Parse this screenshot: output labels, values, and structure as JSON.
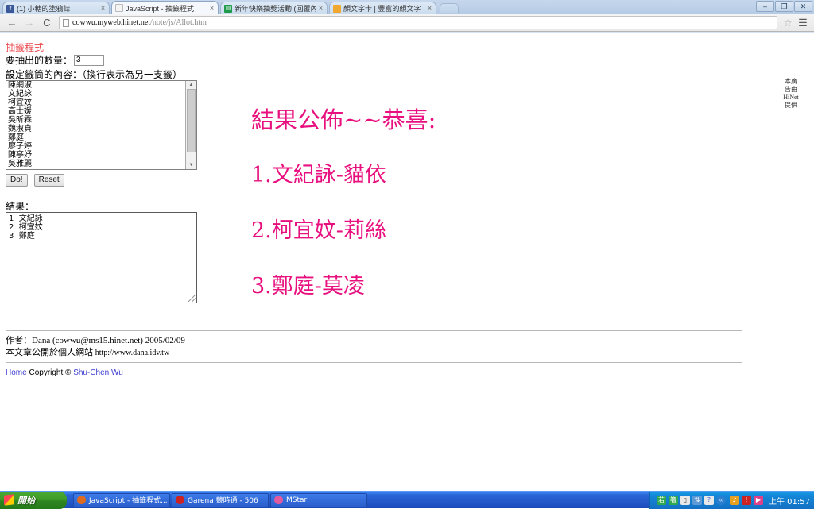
{
  "browser": {
    "tabs": [
      {
        "label": "(1) 小糖的塗鴉誌",
        "favicon": "facebook-icon",
        "active": false
      },
      {
        "label": "JavaScript - 抽籤程式",
        "favicon": "document-icon",
        "active": true
      },
      {
        "label": "新年快樂抽獎活動 (回覆內",
        "favicon": "spreadsheet-icon",
        "active": false
      },
      {
        "label": "顏文字卡 | 豐富的顏文字",
        "favicon": "page-orange-icon",
        "active": false
      }
    ],
    "tab_close_label": "×",
    "new_tab_label": "",
    "window_controls": {
      "minimize": "–",
      "restore": "❐",
      "close": "✕"
    },
    "nav": {
      "back": "←",
      "forward": "→",
      "reload": "C"
    },
    "url": {
      "domain": "cowwu.myweb.hinet.net",
      "path": "/note/js/Allot.htm"
    },
    "bookmark_star": "☆",
    "menu_glyph": "☰"
  },
  "page": {
    "app_title": "抽籤程式",
    "quantity_label": "要抽出的數量：",
    "quantity_value": "3",
    "pool_label": "設定籤筒的內容：（換行表示為另一支籤）",
    "pool_names": [
      "陳網淑",
      "文紀詠",
      "柯宜妏",
      "高士媛",
      "吳昕霖",
      "魏淑貞",
      "鄭庭",
      "廖子婷",
      "陳亭妤",
      "吳雅麗"
    ],
    "buttons": {
      "do": "Do!",
      "reset": "Reset"
    },
    "result_label": "結果：",
    "result_lines": [
      "1  文紀詠",
      "2  柯宜妏",
      "3  鄭庭"
    ],
    "announcement": {
      "heading": "結果公佈~~恭喜:",
      "winners": [
        "1.文紀詠-貓依",
        "2.柯宜妏-莉絲",
        "3.鄭庭-莫凌"
      ],
      "color": "#e8107f"
    },
    "ad_column": [
      "本廣",
      "告由",
      "HiNet",
      "提供"
    ],
    "footer": {
      "author_line": "作者：Dana (cowwu@ms15.hinet.net) 2005/02/09",
      "site_line_cjk": "本文章公開於個人網站 ",
      "site_line_url": "http://www.dana.idv.tw",
      "home_link": "Home",
      "copyright_text": "Copyright © ",
      "copyright_owner": "Shu-Chen Wu"
    }
  },
  "taskbar": {
    "start_label": "開始",
    "items": [
      {
        "label": "JavaScript - 抽籤程式...",
        "icon_color": "#dd6a1f"
      },
      {
        "label": "Garena 競時通 - 506",
        "icon_color": "#cc2222"
      },
      {
        "label": "MStar",
        "icon_color": "#e05aa0"
      }
    ],
    "tray_icons": [
      "ime-icon",
      "ime-alt-icon",
      "panel-icon",
      "network-icon",
      "help-icon"
    ],
    "tray_chevron": "«",
    "tray_extra_icons": [
      "volume-icon",
      "security-icon",
      "media-icon"
    ],
    "clock": "上午 01:57"
  }
}
